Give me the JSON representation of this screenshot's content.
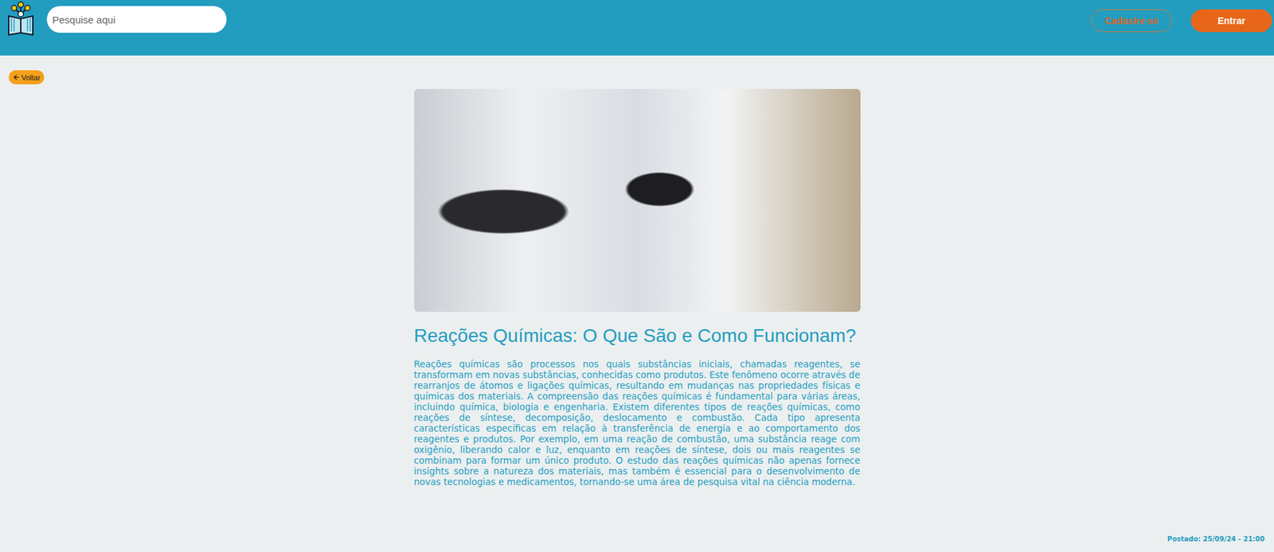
{
  "header": {
    "search": {
      "placeholder": "Pesquise aqui"
    },
    "buttons": [
      {
        "label": "Cadastre-se",
        "kind": "outline"
      },
      {
        "label": "Entrar",
        "kind": "filled"
      }
    ]
  },
  "back_button": {
    "label": "Voltar"
  },
  "article": {
    "title": "Reações Químicas: O Que São e Como Funcionam?",
    "body": "Reações químicas são processos nos quais substâncias iniciais, chamadas reagentes, se transformam em novas substâncias, conhecidas como produtos. Este fenômeno ocorre através de rearranjos de átomos e ligações químicas, resultando em mudanças nas propriedades físicas e químicas dos materiais. A compreensão das reações químicas é fundamental para várias áreas, incluindo química, biologia e engenharia. Existem diferentes tipos de reações químicas, como reações de síntese, decomposição, deslocamento e combustão. Cada tipo apresenta características específicas em relação à transferência de energia e ao comportamento dos reagentes e produtos. Por exemplo, em uma reação de combustão, uma substância reage com oxigênio, liberando calor e luz, enquanto em reações de síntese, dois ou mais reagentes se combinam para formar um único produto. O estudo das reações químicas não apenas fornece insights sobre a natureza dos materiais, mas também é essencial para o desenvolvimento de novas tecnologias e medicamentos, tornando-se uma área de pesquisa vital na ciência moderna."
  },
  "footer": {
    "posted": "Postado: 25/09/24 - 21:00"
  }
}
